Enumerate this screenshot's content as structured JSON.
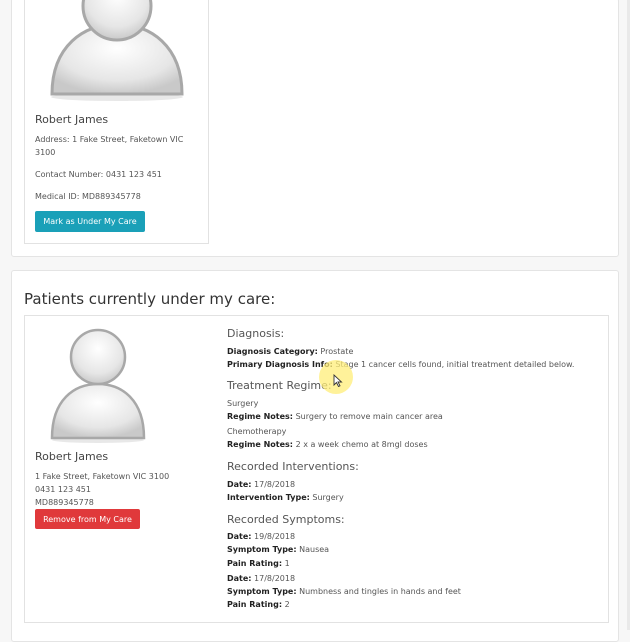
{
  "top_card": {
    "name": "Robert James",
    "address_line1": "Address: 1 Fake Street, Faketown VIC",
    "address_line2": "3100",
    "contact": "Contact Number: 0431 123 451",
    "medical_id": "Medical ID: MD889345778",
    "mark_button": "Mark as Under My Care"
  },
  "care_section": {
    "title": "Patients currently under my care:",
    "patient": {
      "name": "Robert James",
      "address": "1 Fake Street, Faketown VIC 3100",
      "phone": "0431 123 451",
      "medical_id": "MD889345778",
      "remove_button": "Remove from My Care"
    },
    "diagnosis": {
      "heading": "Diagnosis:",
      "category_label": "Diagnosis Category:",
      "category_value": "Prostate",
      "primary_label": "Primary Diagnosis Info:",
      "primary_value": "Stage 1 cancer cells found, initial treatment detailed below."
    },
    "treatment": {
      "heading": "Treatment Regime:",
      "notes_label": "Regime Notes:",
      "items": [
        {
          "name": "Surgery",
          "notes": "Surgery to remove main cancer area"
        },
        {
          "name": "Chemotherapy",
          "notes": "2 x a week chemo at 8mgl doses"
        }
      ]
    },
    "interventions": {
      "heading": "Recorded Interventions:",
      "date_label": "Date:",
      "type_label": "Intervention Type:",
      "items": [
        {
          "date": "17/8/2018",
          "type": "Surgery"
        }
      ]
    },
    "symptoms": {
      "heading": "Recorded Symptoms:",
      "date_label": "Date:",
      "type_label": "Symptom Type:",
      "rating_label": "Pain Rating:",
      "items": [
        {
          "date": "19/8/2018",
          "type": "Nausea",
          "rating": "1"
        },
        {
          "date": "17/8/2018",
          "type": "Numbness and tingles in hands and feet",
          "rating": "2"
        }
      ]
    }
  },
  "colors": {
    "mark_button": "#1aa0b8",
    "remove_button": "#e0393b",
    "cursor_highlight": "#ffee78"
  }
}
